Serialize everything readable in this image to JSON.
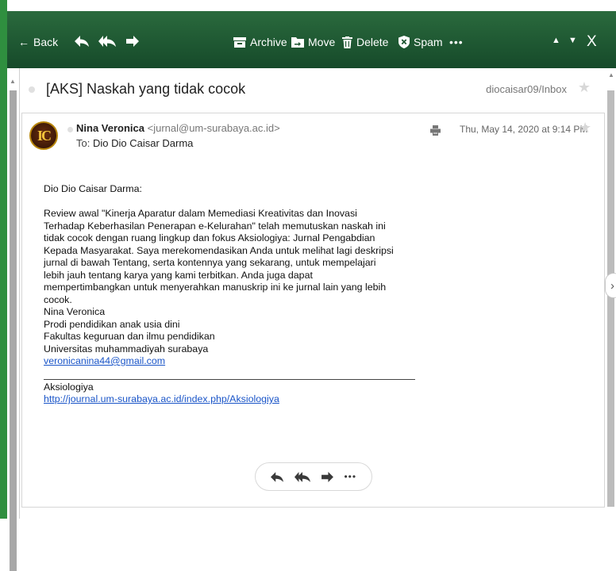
{
  "toolbar": {
    "back_label": "Back",
    "archive_label": "Archive",
    "move_label": "Move",
    "delete_label": "Delete",
    "spam_label": "Spam",
    "more_label": "•••",
    "close_label": "X",
    "color": "#1c5530"
  },
  "message": {
    "subject": "[AKS] Naskah yang tidak cocok",
    "folder": "diocaisar09/Inbox",
    "sender_name": "Nina Veronica",
    "sender_email": "<jurnal@um-surabaya.ac.id>",
    "to_label": "To:",
    "to_name": "Dio Dio Caisar Darma",
    "date": "Thu, May 14, 2020 at 9:14 PM",
    "avatar_text": "IC"
  },
  "body": {
    "greeting": "Dio Dio Caisar Darma:",
    "lines": [
      "Review awal \"Kinerja Aparatur dalam Memediasi Kreativitas dan Inovasi",
      "Terhadap Keberhasilan Penerapan e-Kelurahan\" telah memutuskan naskah ini",
      "tidak cocok dengan ruang lingkup dan fokus Aksiologiya: Jurnal Pengabdian",
      "Kepada Masyarakat. Saya merekomendasikan Anda untuk melihat lagi deskripsi",
      "jurnal di bawah Tentang, serta kontennya yang sekarang, untuk mempelajari",
      "lebih jauh tentang karya yang kami terbitkan. Anda juga dapat",
      "mempertimbangkan untuk menyerahkan manuskrip ini ke jurnal lain yang lebih",
      "cocok."
    ],
    "signature": [
      "Nina Veronica",
      "Prodi pendidikan anak usia dini",
      "Fakultas keguruan dan ilmu pendidikan",
      "Universitas muhammadiyah surabaya"
    ],
    "signature_email": "veronicanina44@gmail.com",
    "journal_name": "Aksiologiya",
    "journal_url": "http://journal.um-surabaya.ac.id/index.php/Aksiologiya"
  },
  "actions": {
    "more_label": "•••"
  }
}
